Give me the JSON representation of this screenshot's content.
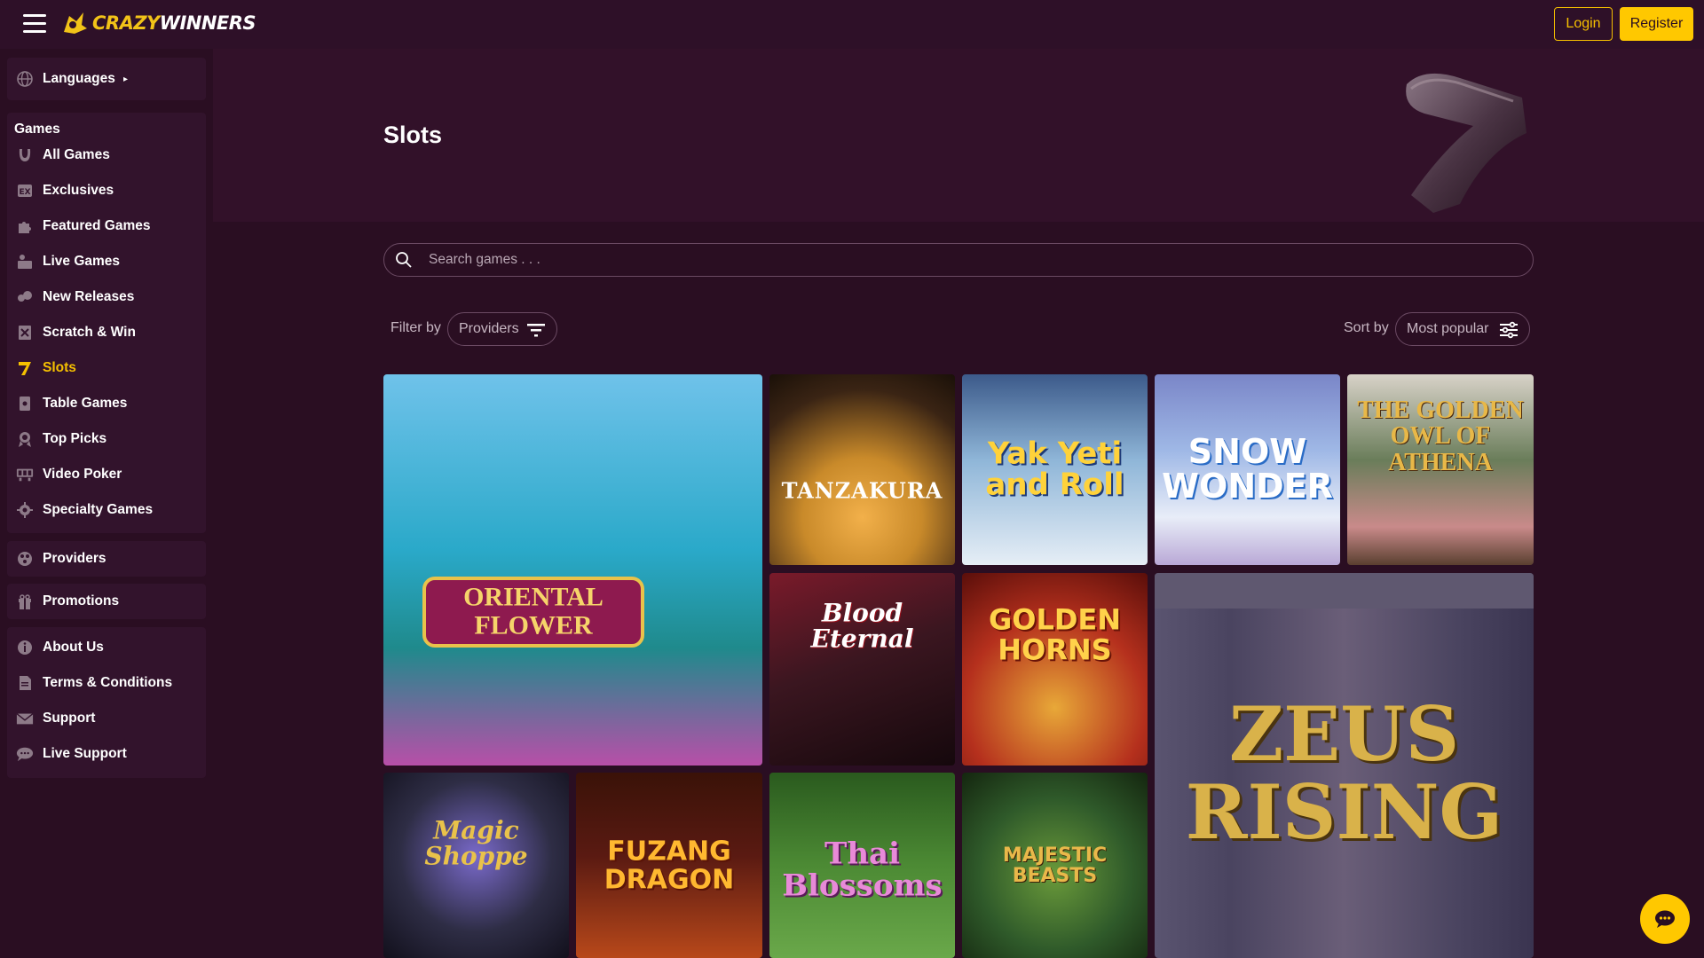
{
  "header": {
    "logo_text_a": "CRAZY",
    "logo_text_b": "WINNERS",
    "login_label": "Login",
    "register_label": "Register"
  },
  "sidebar": {
    "languages_label": "Languages",
    "games_heading": "Games",
    "game_items": [
      {
        "label": "All Games",
        "icon": "horseshoe-icon"
      },
      {
        "label": "Exclusives",
        "icon": "exclusive-badge-icon"
      },
      {
        "label": "Featured Games",
        "icon": "puzzle-icon"
      },
      {
        "label": "Live Games",
        "icon": "live-dealer-icon"
      },
      {
        "label": "New Releases",
        "icon": "new-releases-icon"
      },
      {
        "label": "Scratch & Win",
        "icon": "scratch-card-icon"
      },
      {
        "label": "Slots",
        "icon": "seven-icon"
      },
      {
        "label": "Table Games",
        "icon": "cards-icon"
      },
      {
        "label": "Top Picks",
        "icon": "ribbon-icon"
      },
      {
        "label": "Video Poker",
        "icon": "video-poker-icon"
      },
      {
        "label": "Specialty Games",
        "icon": "gear-icon"
      }
    ],
    "providers_label": "Providers",
    "promotions_label": "Promotions",
    "info_items": [
      {
        "label": "About Us",
        "icon": "info-icon"
      },
      {
        "label": "Terms & Conditions",
        "icon": "document-icon"
      },
      {
        "label": "Support",
        "icon": "mail-icon"
      },
      {
        "label": "Live Support",
        "icon": "chat-icon"
      }
    ]
  },
  "page": {
    "title": "Slots"
  },
  "search": {
    "placeholder": "Search games . . ."
  },
  "filters": {
    "filter_by_label": "Filter by",
    "providers_value": "Providers",
    "sort_by_label": "Sort by",
    "sort_value": "Most popular"
  },
  "games": [
    {
      "title": "ORIENTAL FLOWER",
      "bg": "#2aa9c9"
    },
    {
      "title": "TANZAKURA",
      "bg": "#c98a2a"
    },
    {
      "title": "Yak Yeti and Roll",
      "bg": "#8fb6d8"
    },
    {
      "title": "SNOW WONDER",
      "bg": "#9fb8e6"
    },
    {
      "title": "THE GOLDEN OWL OF ATHENA",
      "bg": "#6a7d5a"
    },
    {
      "title": "Blood Eternal",
      "bg": "#3b1620"
    },
    {
      "title": "GOLDEN HORNS",
      "bg": "#b5301d"
    },
    {
      "title": "ZEUS RISING",
      "bg": "#4a4460"
    },
    {
      "title": "Magic Shoppe",
      "bg": "#2e2d45"
    },
    {
      "title": "FUZANG DRAGON",
      "bg": "#5a1a12"
    },
    {
      "title": "Thai Blossoms",
      "bg": "#4c8a34"
    },
    {
      "title": "MAJESTIC BEASTS",
      "bg": "#2f5a2a"
    }
  ],
  "colors": {
    "accent": "#ffc800",
    "background": "#2a0e22",
    "sidebar_block": "#32132c"
  }
}
